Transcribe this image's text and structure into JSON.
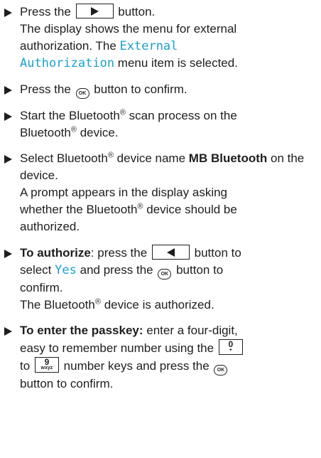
{
  "steps": [
    {
      "a": "Press the",
      "b": "button.",
      "line2": "The display shows the menu for external",
      "line3": "authorization. The",
      "mono1": "External",
      "mono2": "Authorization",
      "line4": "menu item is selected."
    },
    {
      "a": "Press the",
      "ok": "OK",
      "b": "button to confirm."
    },
    {
      "a": "Start the Bluetooth",
      "reg": "®",
      "b": "scan process on the",
      "c": "Bluetooth",
      "d": "device."
    },
    {
      "a": "Select Bluetooth",
      "reg": "®",
      "b": "device name",
      "bold": "MB Bluetooth",
      "c": "on the device.",
      "line2": "A prompt appears in the display asking",
      "line3a": "whether the Bluetooth",
      "line3b": "device should be",
      "line4": "authorized."
    },
    {
      "bold": "To authorize",
      "a": ": press the",
      "b": "button to",
      "c": "select",
      "yes": "Yes",
      "d": "and press the",
      "ok": "OK",
      "e": "button to",
      "f": "confirm.",
      "g1": "The Bluetooth",
      "g2": "device is authorized."
    },
    {
      "bold": "To enter the passkey:",
      "a": "enter a four-digit,",
      "b": "easy to remember number using the",
      "key1n": "0",
      "key1s": "+",
      "c": "to",
      "key2n": "9",
      "key2s": "wxyz",
      "d": "number keys and press the",
      "ok": "OK",
      "e": "button to confirm."
    }
  ]
}
